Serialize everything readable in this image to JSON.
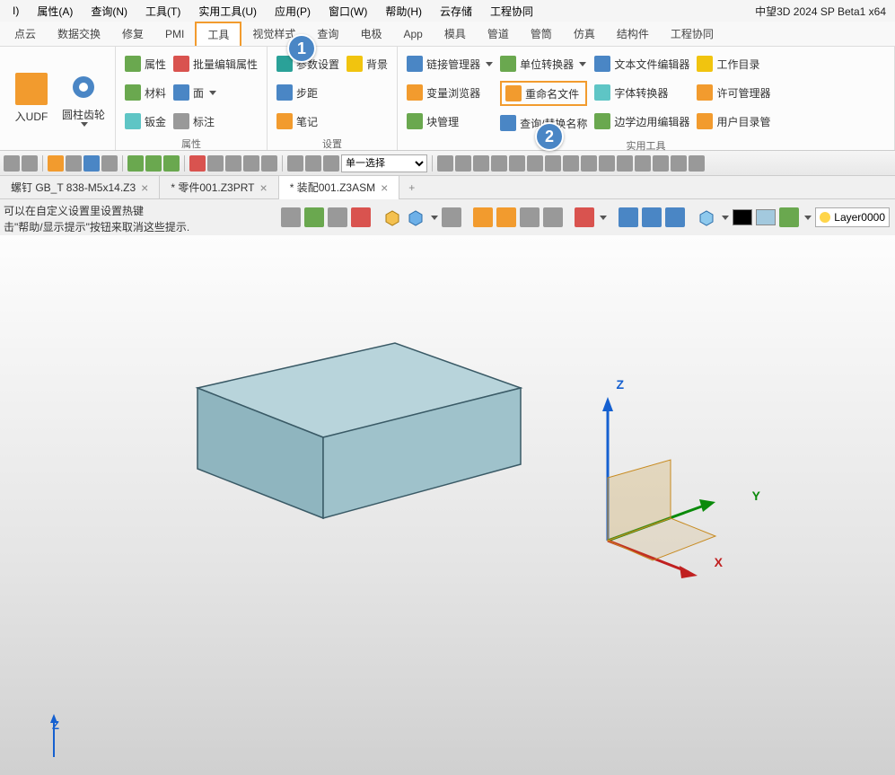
{
  "app_title": "中望3D 2024 SP Beta1 x64",
  "menubar": [
    "I)",
    "属性(A)",
    "查询(N)",
    "工具(T)",
    "实用工具(U)",
    "应用(P)",
    "窗口(W)",
    "帮助(H)",
    "云存储",
    "工程协同"
  ],
  "tabbar": [
    "点云",
    "数据交换",
    "修复",
    "PMI",
    "工具",
    "视觉样式",
    "查询",
    "电极",
    "App",
    "模具",
    "管道",
    "管筒",
    "仿真",
    "结构件",
    "工程协同"
  ],
  "tabbar_active_index": 4,
  "ribbon": {
    "group1": {
      "btns": [
        "入UDF",
        "圆柱齿轮"
      ],
      "label": ""
    },
    "group_attr": {
      "col1": [
        "属性",
        "材料",
        "钣金"
      ],
      "col2": [
        "批量编辑属性",
        "面",
        "标注"
      ],
      "label": "属性"
    },
    "group_set": {
      "col1": [
        "参数设置",
        "步距",
        "笔记"
      ],
      "col2": [
        "背景"
      ],
      "label": "设置"
    },
    "group_util": {
      "col1": [
        "链接管理器",
        "变量浏览器",
        "块管理"
      ],
      "col2": [
        "单位转换器",
        "重命名文件",
        "查询/替换名称"
      ],
      "col3": [
        "文本文件编辑器",
        "字体转换器",
        "边学边用编辑器"
      ],
      "col4": [
        "工作目录",
        "许可管理器",
        "用户目录管"
      ],
      "label": "实用工具"
    }
  },
  "annotations": {
    "one": "1",
    "two": "2"
  },
  "quickbar_select": "单一选择",
  "doctabs": [
    {
      "label": "螺钉 GB_T 838-M5x14.Z3",
      "active": false
    },
    {
      "label": "* 零件001.Z3PRT",
      "active": false
    },
    {
      "label": "* 装配001.Z3ASM",
      "active": true
    }
  ],
  "hint": {
    "line1": "可以在自定义设置里设置热键",
    "line2": "击\"帮助/显示提示\"按钮来取消这些提示."
  },
  "layer_label": "Layer0000",
  "axes": {
    "x": "X",
    "y": "Y",
    "z": "Z"
  }
}
